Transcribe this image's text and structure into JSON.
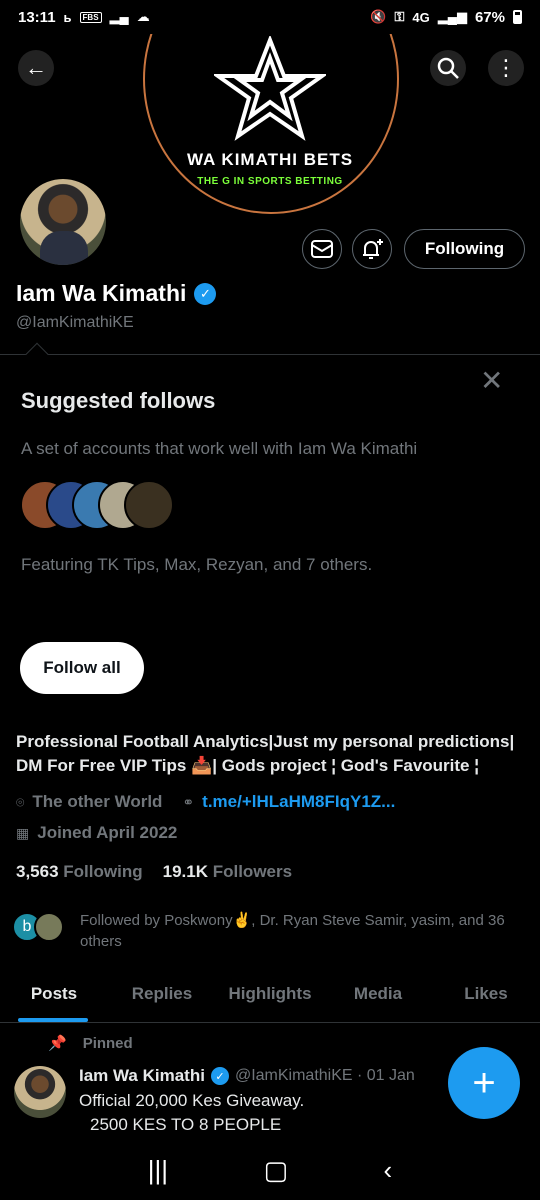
{
  "status_bar": {
    "time": "13:11",
    "left_icons": [
      "b-icon",
      "fbs-icon",
      "signal-icon",
      "cloud-icon"
    ],
    "fbs_label": "FBS",
    "network": "4G",
    "battery": "67%"
  },
  "banner": {
    "title": "WA KIMATHI BETS",
    "tagline": "THE G IN SPORTS BETTING",
    "ring_color": "#c9753f",
    "tagline_color": "#7cff3a"
  },
  "profile": {
    "name": "Iam Wa Kimathi",
    "verified_mark": "✓",
    "handle": "@IamKimathiKE",
    "following_button": "Following",
    "bio_line1": "Professional Football Analytics|Just my personal predictions|",
    "bio_line2": "DM For Free VIP Tips 📥| Gods project ¦ God's Favourite ¦",
    "location": "The other World",
    "link": "t.me/+lHLaHM8FIqY1Z...",
    "joined": "Joined April 2022",
    "following_count": "3,563",
    "following_label": "Following",
    "followers_count": "19.1K",
    "followers_label": "Followers",
    "followed_by_initial": "b",
    "followed_by": "Followed by Poskwony✌️, Dr. Ryan Steve Samir, yasim, and 36 others"
  },
  "suggested": {
    "title": "Suggested follows",
    "description": "A set of accounts that work well with Iam Wa Kimathi",
    "featuring": "Featuring TK Tips, Max, Rezyan, and 7 others.",
    "follow_all": "Follow all",
    "avatar_colors": [
      "#8a4a2a",
      "#2a4a8a",
      "#3a7ab0",
      "#b0a890",
      "#3a3020"
    ]
  },
  "tabs": [
    "Posts",
    "Replies",
    "Highlights",
    "Media",
    "Likes"
  ],
  "pinned_post": {
    "pinned_label": "Pinned",
    "author": "Iam Wa Kimathi",
    "handle_date": "@IamKimathiKE · 01 Jan",
    "line1": "Official 20,000 Kes Giveaway.",
    "line2": "2500 KES TO 8 PEOPLE"
  },
  "fab_label": "+",
  "colors": {
    "accent": "#1d9bf0",
    "muted": "#71767b",
    "background": "#000000"
  }
}
